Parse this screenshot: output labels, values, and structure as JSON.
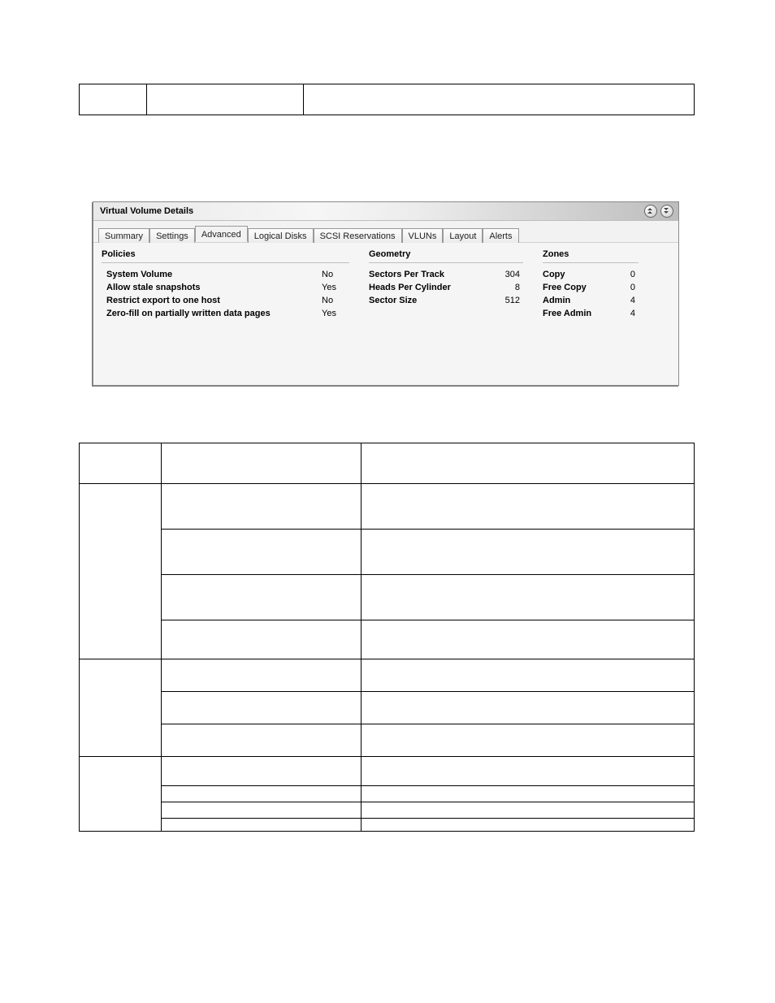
{
  "panel": {
    "title": "Virtual Volume Details",
    "tabs": [
      "Summary",
      "Settings",
      "Advanced",
      "Logical Disks",
      "SCSI Reservations",
      "VLUNs",
      "Layout",
      "Alerts"
    ],
    "activeTabIndex": 2
  },
  "policies": {
    "header": "Policies",
    "rows": [
      {
        "label": "System Volume",
        "value": "No"
      },
      {
        "label": "Allow stale snapshots",
        "value": "Yes"
      },
      {
        "label": "Restrict export to one host",
        "value": "No"
      },
      {
        "label": "Zero-fill on partially written data pages",
        "value": "Yes"
      }
    ]
  },
  "geometry": {
    "header": "Geometry",
    "rows": [
      {
        "label": "Sectors Per Track",
        "value": "304"
      },
      {
        "label": "Heads Per Cylinder",
        "value": "8"
      },
      {
        "label": "Sector Size",
        "value": "512"
      }
    ]
  },
  "zones": {
    "header": "Zones",
    "rows": [
      {
        "label": "Copy",
        "value": "0"
      },
      {
        "label": "Free Copy",
        "value": "0"
      },
      {
        "label": "Admin",
        "value": "4"
      },
      {
        "label": "Free Admin",
        "value": "4"
      }
    ]
  }
}
